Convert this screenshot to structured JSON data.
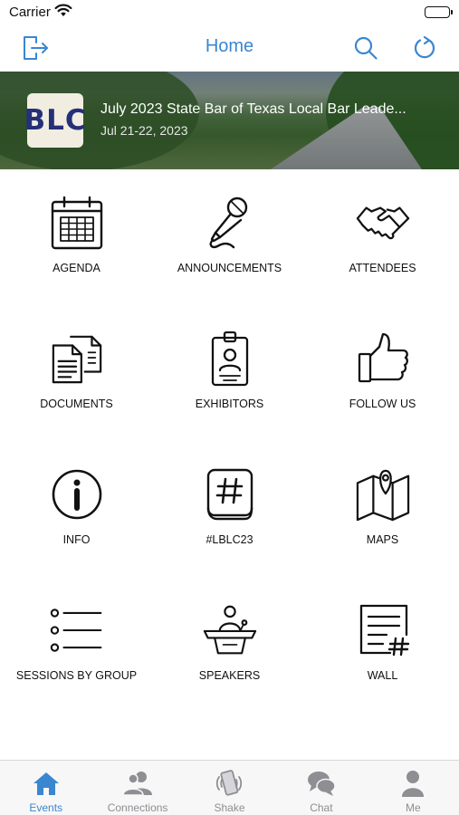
{
  "status_bar": {
    "carrier": "Carrier"
  },
  "nav": {
    "title": "Home",
    "exit_icon": "exit-icon",
    "search_icon": "search-icon",
    "refresh_icon": "refresh-icon",
    "accent_color": "#3a86d1"
  },
  "event": {
    "logo_text": "BLC",
    "title": "July 2023 State Bar of Texas Local Bar Leade...",
    "dates": "Jul 21-22, 2023"
  },
  "tiles": [
    {
      "label": "AGENDA",
      "icon": "calendar-icon"
    },
    {
      "label": "ANNOUNCEMENTS",
      "icon": "microphone-icon"
    },
    {
      "label": "ATTENDEES",
      "icon": "handshake-icon"
    },
    {
      "label": "DOCUMENTS",
      "icon": "documents-icon"
    },
    {
      "label": "EXHIBITORS",
      "icon": "id-badge-icon"
    },
    {
      "label": "FOLLOW US",
      "icon": "thumbs-up-icon"
    },
    {
      "label": "INFO",
      "icon": "info-icon"
    },
    {
      "label": "#LBLC23",
      "icon": "hashtag-icon"
    },
    {
      "label": "MAPS",
      "icon": "map-icon"
    },
    {
      "label": "SESSIONS BY GROUP",
      "icon": "list-icon"
    },
    {
      "label": "SPEAKERS",
      "icon": "podium-speaker-icon"
    },
    {
      "label": "WALL",
      "icon": "wall-post-icon"
    }
  ],
  "tab_bar": {
    "active": "Events",
    "tabs": [
      {
        "label": "Events",
        "icon": "house-icon"
      },
      {
        "label": "Connections",
        "icon": "people-icon"
      },
      {
        "label": "Shake",
        "icon": "shake-phone-icon"
      },
      {
        "label": "Chat",
        "icon": "chat-bubbles-icon"
      },
      {
        "label": "Me",
        "icon": "person-icon"
      }
    ],
    "active_color": "#3a86d1",
    "inactive_color": "#8e8e93"
  }
}
